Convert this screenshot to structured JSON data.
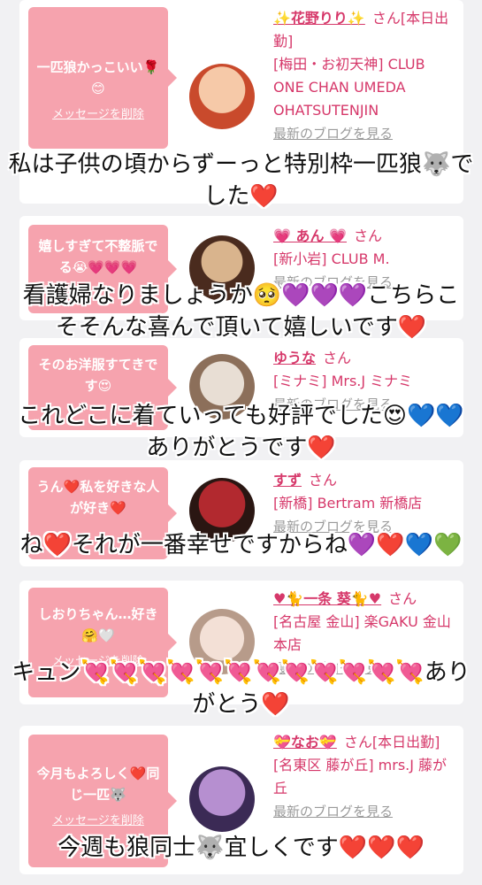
{
  "cards": [
    {
      "message": "一匹狼かっこいい🌹😊",
      "delete_label": "メッセージを削除",
      "name": "✨花野りり✨",
      "san": "さん[本日出勤]",
      "shop": "[梅田・お初天神] CLUB ONE CHAN UMEDA OHATSUTENJIN",
      "blog": "最新のブログを見る",
      "avatar_colors": [
        "#f6c9a8",
        "#c94a2c"
      ]
    },
    {
      "message": "嬉しすぎて不整脈でる😭💗💗💗",
      "delete_label": "メッセージを削除",
      "name": "💗 あん 💗",
      "san": "さん",
      "shop": "[新小岩] CLUB M.",
      "blog": "最新のブログを見る",
      "avatar_colors": [
        "#d9b48d",
        "#4a2b1e"
      ]
    },
    {
      "message": "そのお洋服すてきです😍",
      "delete_label": "メッセージを削除",
      "name": "ゆうな",
      "san": "さん",
      "shop": "[ミナミ] Mrs.J ミナミ",
      "blog": "最新のブログを見る",
      "avatar_colors": [
        "#e8ded4",
        "#8c6f5a"
      ]
    },
    {
      "message": "うん❤️私を好きな人が好き❤️",
      "delete_label": "メッセージを削除",
      "name": "すず",
      "san": "さん",
      "shop": "[新橋] Bertram 新橋店",
      "blog": "最新のブログを見る",
      "avatar_colors": [
        "#b2292f",
        "#2a1612"
      ]
    },
    {
      "message": "しおりちゃん…好き🤗🤍",
      "delete_label": "メッセージを削除",
      "name": "♥🐈一条 葵🐈♥",
      "san": "さん",
      "shop": "[名古屋 金山] 楽GAKU 金山本店",
      "blog": "最新のブログを見る",
      "avatar_colors": [
        "#f3e0d6",
        "#b79b8a"
      ]
    },
    {
      "message": "今月もよろしく❤️同じ一匹🐺",
      "delete_label": "メッセージを削除",
      "name": "💝なお💝",
      "san": "さん[本日出勤]",
      "shop": "[名東区 藤が丘] mrs.J 藤が丘",
      "blog": "最新のブログを見る",
      "avatar_colors": [
        "#b68fd0",
        "#3b2a55"
      ]
    }
  ],
  "captions": [
    "私は子供の頃からずーっと特別枠一匹狼🐺でした❤️",
    "看護婦なりましょうか🥺💜💜💜こちらこそそんな喜んで頂いて嬉しいです❤️",
    "これどこに着ていっても好評でした😍💙💙ありがとうです❤️",
    "ね❤️それが一番幸せですからね💜❤️💙💚",
    "キュン💘💘💘💘💘💘💘💘💘💘💘💘ありがとう❤️",
    "今週も狼同士🐺宜しくです❤️❤️❤️"
  ]
}
